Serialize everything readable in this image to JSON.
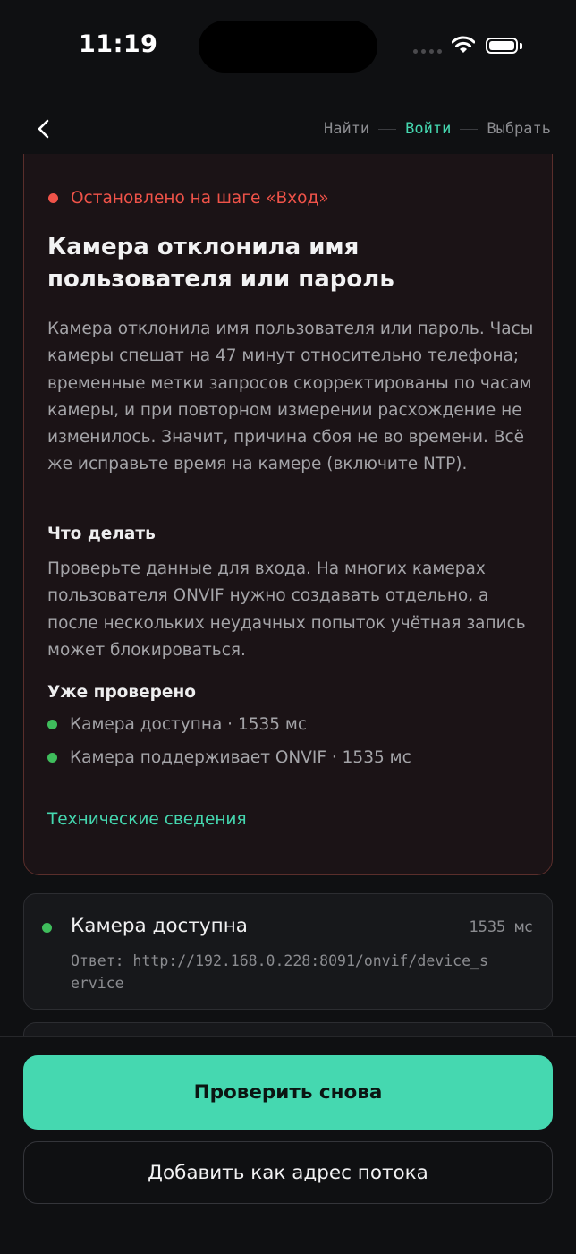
{
  "status_bar": {
    "time": "11:19"
  },
  "nav": {
    "steps": [
      {
        "label": "Найти"
      },
      {
        "label": "Войти"
      },
      {
        "label": "Выбрать"
      }
    ],
    "active_step": "Войти"
  },
  "error_card": {
    "status": "Остановлено на шаге «Вход»",
    "title": "Камера отклонила имя пользователя или пароль",
    "description": "Камера отклонила имя пользователя или пароль. Часы камеры спешат на 47 минут относительно телефона; временные метки запросов скорректированы по часам камеры, и при повторном измерении расхождение не изменилось. Значит, причина сбоя не во времени. Всё же исправьте время на камере (включите NTP).",
    "what_to_do_heading": "Что делать",
    "what_to_do_body": "Проверьте данные для входа. На многих камерах пользователя ONVIF нужно создавать отдельно, а после нескольких неудачных попыток учётная запись может блокироваться.",
    "checked_heading": "Уже проверено",
    "checked_items": [
      "Камера доступна · 1535 мс",
      "Камера поддерживает ONVIF · 1535 мс"
    ],
    "tech_link": "Технические сведения"
  },
  "step_cards": [
    {
      "title": "Камера доступна",
      "duration": "1535 мс",
      "response": "Ответ: http://192.168.0.228:8091/onvif/device_service"
    }
  ],
  "actions": {
    "retry_label": "Проверить снова",
    "add_stream_label": "Добавить как адрес потока"
  },
  "colors": {
    "accent": "#45d8b0",
    "error": "#f05349",
    "success": "#3fbd5c",
    "background": "#0f1012"
  },
  "icons": {
    "back": "chevron-left-icon",
    "signal": "cellular-signal-icon",
    "wifi": "wifi-icon",
    "battery": "battery-icon"
  }
}
